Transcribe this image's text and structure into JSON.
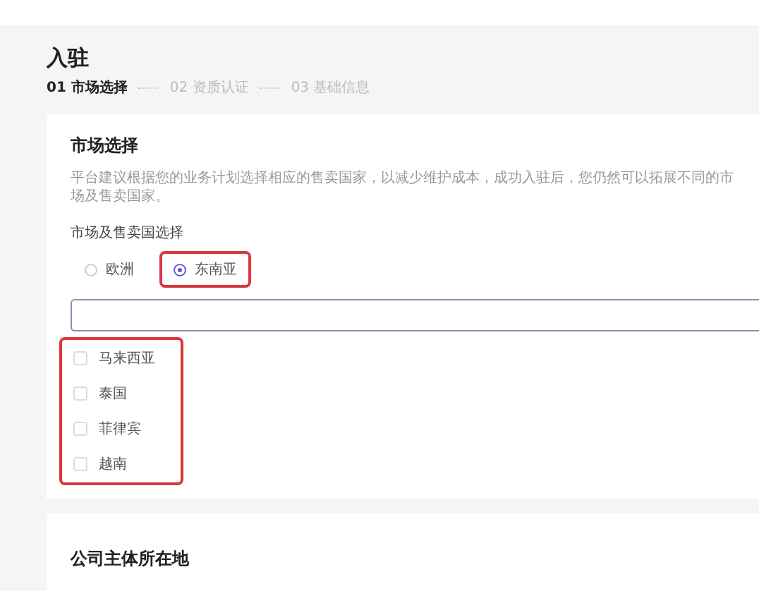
{
  "page_title": "入驻",
  "steps": [
    {
      "label": "01 市场选择",
      "selected": true
    },
    {
      "label": "02 资质认证",
      "selected": false
    },
    {
      "label": "03 基础信息",
      "selected": false
    }
  ],
  "market_section": {
    "heading": "市场选择",
    "description": "平台建议根据您的业务计划选择相应的售卖国家，以减少维护成本，成功入驻后，您仍然可以拓展不同的市场及售卖国家。",
    "field_label": "市场及售卖国选择",
    "regions": [
      {
        "label": "欧洲",
        "selected": false,
        "highlighted": false
      },
      {
        "label": "东南亚",
        "selected": true,
        "highlighted": true
      }
    ],
    "country_list": {
      "highlighted": true,
      "items": [
        {
          "label": "马来西亚",
          "checked": false
        },
        {
          "label": "泰国",
          "checked": false
        },
        {
          "label": "菲律宾",
          "checked": false
        },
        {
          "label": "越南",
          "checked": false
        }
      ]
    }
  },
  "company_section": {
    "heading": "公司主体所在地"
  }
}
